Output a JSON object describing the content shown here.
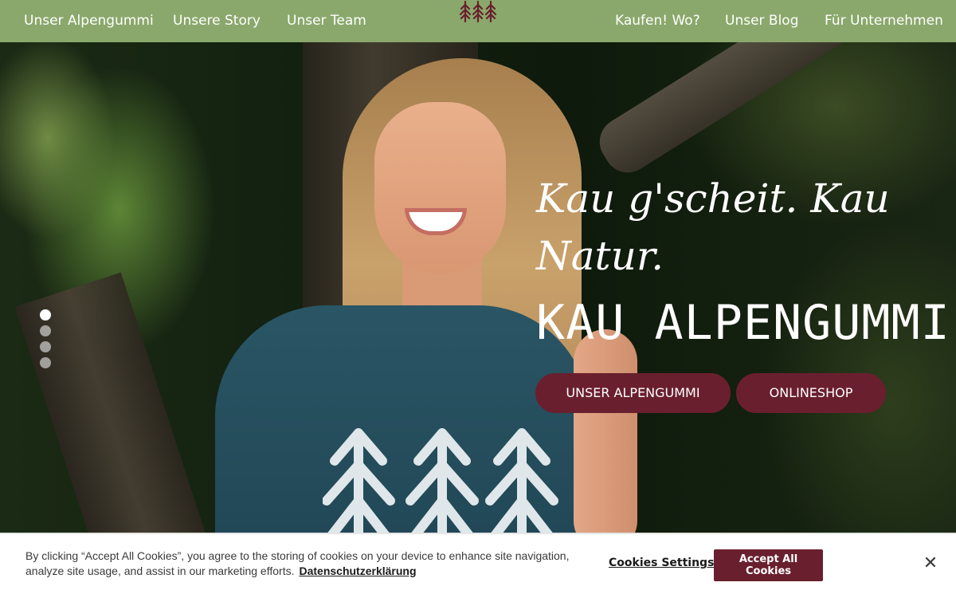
{
  "nav": {
    "left": [
      "Unser Alpengummi",
      "Unsere Story",
      "Unser Team"
    ],
    "right": [
      "Kaufen! Wo?",
      "Unser Blog",
      "Für Unternehmen"
    ],
    "logo_icon": "three-trees-icon"
  },
  "hero": {
    "script_line": "Kau g'scheit. Kau Natur.",
    "headline": "KAU ALPENGUMMI!",
    "buttons": [
      "UNSER ALPENGUMMI",
      "ONLINESHOP"
    ],
    "slider": {
      "count": 4,
      "active_index": 0
    }
  },
  "cookie": {
    "text": "By clicking “Accept All Cookies”, you agree to the storing of cookies on your device to enhance site navigation, analyze site usage, and assist in our marketing efforts.",
    "link": "Datenschutzerklärung",
    "settings_label": "Cookies Settings",
    "accept_label": "Accept All Cookies",
    "close_icon": "close-icon"
  },
  "colors": {
    "nav_bg": "#8aa86b",
    "accent": "#6a1f2e",
    "logo": "#6a1f2e"
  }
}
